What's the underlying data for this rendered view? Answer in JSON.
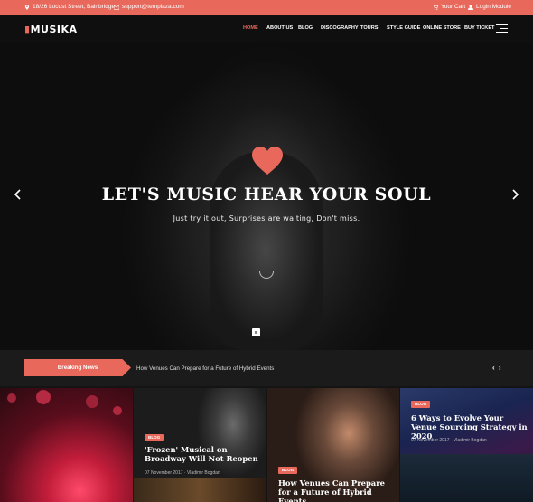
{
  "topbar": {
    "address": "18/26 Locust Street, Bainbridge",
    "email": "support@templaza.com",
    "cart": "Your Cart",
    "login": "Login Module"
  },
  "header": {
    "logo": "MUSIKA",
    "nav": [
      "HOME",
      "ABOUT US",
      "BLOG",
      "DISCOGRAPHY",
      "TOURS",
      "STYLE GUIDE",
      "ONLINE STORE",
      "BUY TICKET"
    ],
    "active_nav": "HOME"
  },
  "hero": {
    "title": "LET'S MUSIC HEAR YOUR SOUL",
    "subtitle": "Just try it out, Surprises are waiting, Don't miss."
  },
  "news": {
    "label": "Breaking News",
    "headline": "How Venues Can Prepare for a Future of Hybrid Events",
    "nav": "‹ ›"
  },
  "cards": [
    {
      "tag": "",
      "title": "",
      "meta": ""
    },
    {
      "tag": "BLOG",
      "title": "'Frozen' Musical on Broadway Will Not Reopen",
      "meta": "07 November 2017 · Vladimir Bogdan"
    },
    {
      "tag": "BLOG",
      "title": "How Venues Can Prepare for a Future of Hybrid Events",
      "meta": ""
    },
    {
      "tag": "BLOG",
      "title": "6 Ways to Evolve Your Venue Sourcing Strategy in 2020",
      "meta": "07 November 2017 · Vladimir Bogdan"
    }
  ],
  "colors": {
    "accent": "#e8695c",
    "header_bg": "#0f0f0f",
    "news_bg": "#1b1b1b"
  },
  "icons": [
    "map-pin-icon",
    "mail-icon",
    "cart-icon",
    "user-icon",
    "heart-icon",
    "chevron-left-icon",
    "chevron-right-icon",
    "hamburger-icon"
  ]
}
